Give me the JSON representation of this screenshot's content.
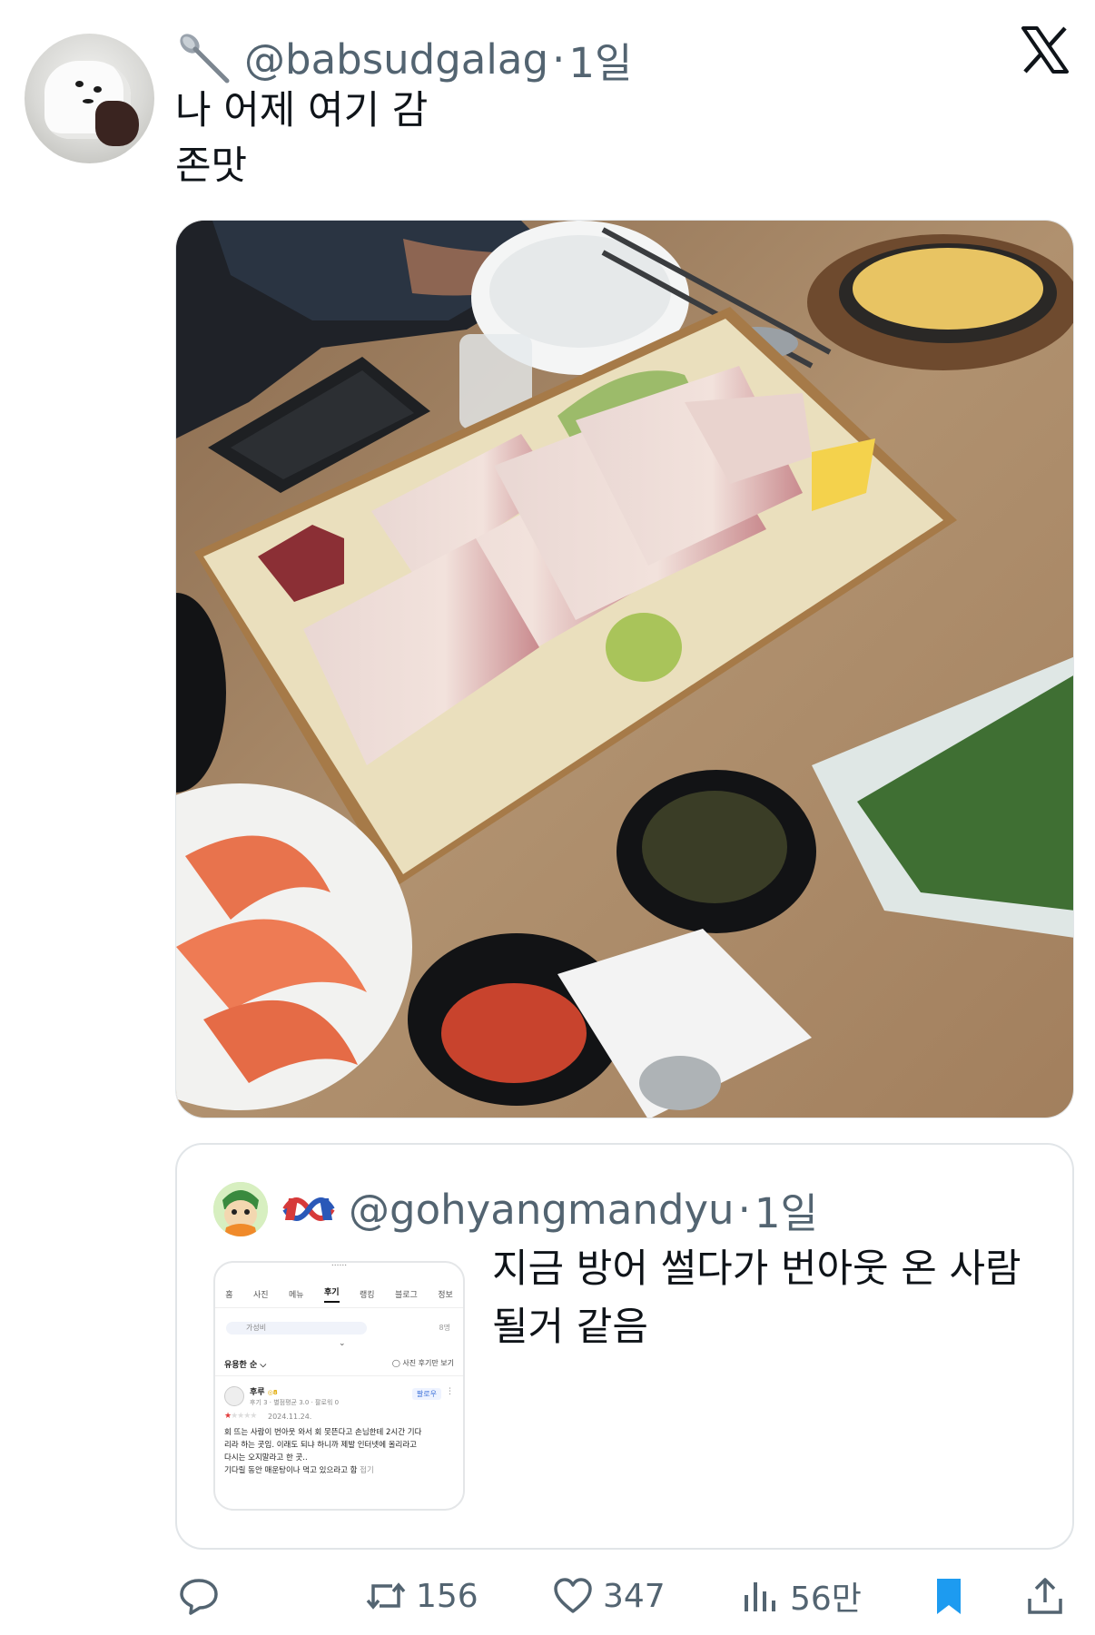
{
  "tweet": {
    "handle": "@babsudgalag",
    "separator": "·",
    "time": "1일",
    "text_line1": "나 어제 여기 감",
    "text_line2": "존맛",
    "header_icon": "spoon-icon"
  },
  "quote": {
    "handle": "@gohyangmandyu",
    "separator": "·",
    "time": "1일",
    "text_line1": "지금 방어 썰다가 번아웃 온 사람",
    "text_line2": "될거 같음",
    "header_icon": "knot-flag-icon",
    "screenshot": {
      "cut_title": "......",
      "tabs": [
        "홈",
        "사진",
        "메뉴",
        "후기",
        "랭킹",
        "블로그",
        "정보"
      ],
      "active_tab": "후기",
      "keyword_bar": "가성비",
      "keyword_count": "8명",
      "sort_label": "유용한 순 ⌵",
      "photo_only": "◯ 사진 후기만 보기",
      "reviewer_name": "후루",
      "reviewer_badge": "◎8",
      "reviewer_meta": "후기 3 · 별점평균 3.0 · 팔로워 0",
      "follow_label": "팔로우",
      "more_dots": "⋮",
      "date": "2024.11.24.",
      "review_line1": "회 뜨는 사람이 번아웃 와서 회 못뜬다고 손님한테 2시간 기다",
      "review_line2": "리라 하는 곳임. 이래도 되냐 하니까 제발 인터넷에 올리라고",
      "review_line3": "다시는 오지말라고 한 곳..",
      "review_line4": "기다릴 동안 매운탕이나 먹고 있으라고 함",
      "review_more": "접기"
    }
  },
  "actions": {
    "reply_icon": "reply-icon",
    "retweet_count": "156",
    "like_count": "347",
    "views_count": "56만",
    "bookmark_icon": "bookmark-icon",
    "share_icon": "share-icon"
  },
  "colors": {
    "text": "#0f1419",
    "secondary": "#536471",
    "border": "#e1e5e8",
    "bookmark": "#1d9bf0"
  }
}
